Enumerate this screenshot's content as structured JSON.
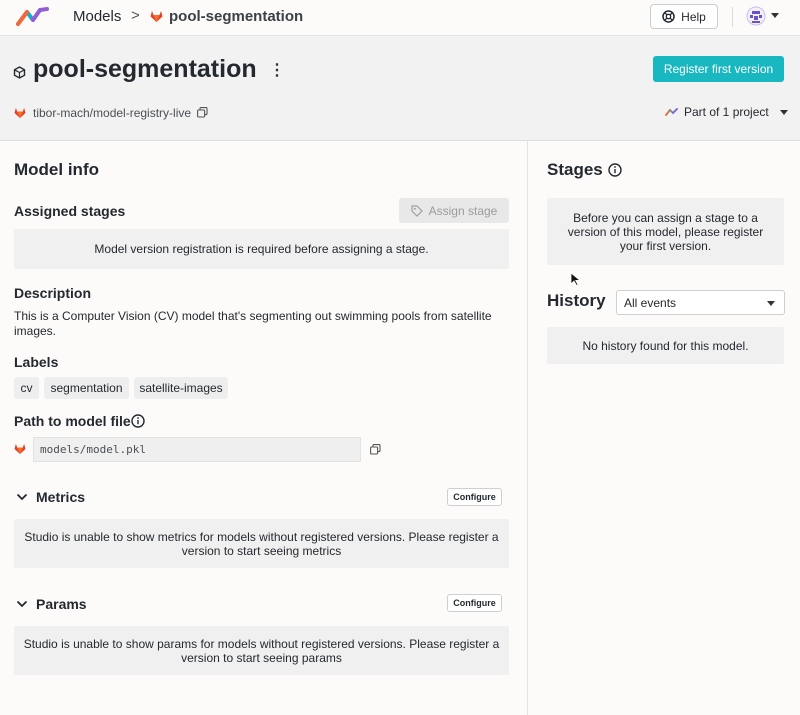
{
  "nav": {
    "breadcrumb_models": "Models",
    "breadcrumb_separator": ">",
    "breadcrumb_model": "pool-segmentation",
    "help_label": "Help"
  },
  "header": {
    "title": "pool-segmentation",
    "register_label": "Register first version",
    "repo_path": "tibor-mach/model-registry-live",
    "project_label": "Part of 1 project"
  },
  "model_info": {
    "heading": "Model info",
    "assigned_stages": {
      "heading": "Assigned stages",
      "button_label": "Assign stage",
      "empty_message": "Model version registration is required before assigning a stage."
    },
    "description": {
      "heading": "Description",
      "text": "This is a Computer Vision (CV) model that's segmenting out swimming pools from satellite images."
    },
    "labels": {
      "heading": "Labels",
      "items": [
        "cv",
        "segmentation",
        "satellite-images"
      ]
    },
    "path": {
      "heading": "Path to model file",
      "value": "models/model.pkl"
    },
    "metrics": {
      "heading": "Metrics",
      "configure_label": "Configure",
      "empty_line1": "Studio is unable to show metrics for models without registered versions. Please register a",
      "empty_line2": "version to start seeing metrics"
    },
    "params": {
      "heading": "Params",
      "configure_label": "Configure",
      "empty_line1": "Studio is unable to show params for models without registered versions. Please register a",
      "empty_line2": "version to start seeing params"
    }
  },
  "stages": {
    "heading": "Stages",
    "empty_line1": "Before you can assign a stage to a",
    "empty_line2": "version of this model, please register",
    "empty_line3": "your first version."
  },
  "history": {
    "heading": "History",
    "filter_value": "All events",
    "empty_message": "No history found for this model."
  },
  "colors": {
    "accent": "#19b8c1",
    "gitlab": "#e2432a",
    "panel_gray": "#f0f0f0"
  }
}
